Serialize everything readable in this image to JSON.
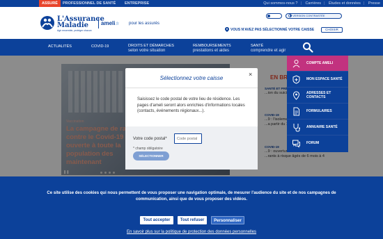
{
  "topbar": {
    "tabs": [
      "Assuré",
      "Professionnel de santé",
      "Entreprise"
    ],
    "links": [
      "Qui sommes-nous ?",
      "Carrières",
      "Études et données",
      "Presse"
    ]
  },
  "header": {
    "logo_line1": "L'Assurance",
    "logo_line2": "Maladie",
    "logo_tagline": "Agir ensemble, protéger chacun",
    "ameli": "ameli",
    "ameli_suffix": ".fr",
    "pour": "pour les assurés",
    "version_label": "VERSION CONTRASTÉE",
    "caisse_status": "VOUS N'AVEZ PAS SÉLECTIONNÉ VOTRE CAISSE",
    "choisir": "CHOISIR"
  },
  "nav": {
    "items": [
      {
        "main": "ACTUALITÉS",
        "sub": ""
      },
      {
        "main": "COVID-19",
        "sub": ""
      },
      {
        "main": "DROITS ET DÉMARCHES",
        "sub": "selon votre situation"
      },
      {
        "main": "REMBOURSEMENTS",
        "sub": "prestations et aides"
      },
      {
        "main": "SANTÉ",
        "sub": "comprendre et agir"
      }
    ]
  },
  "dropdown": {
    "items": [
      {
        "label": "COMPTE AMELI",
        "icon": "person-icon"
      },
      {
        "label": "MON ESPACE SANTÉ",
        "icon": "shield-cross-icon"
      },
      {
        "label": "ADRESSES ET CONTACTS",
        "icon": "location-icon"
      },
      {
        "label": "FORMULAIRES",
        "icon": "document-icon"
      },
      {
        "label": "ANNUAIRE SANTÉ",
        "icon": "stethoscope-icon"
      },
      {
        "label": "FORUM",
        "icon": "chat-icon"
      }
    ]
  },
  "hero": {
    "tag": "Vaccination",
    "title": "La campagne de rappel contre le Covid-19 est ouverte à toute la population des maintenant"
  },
  "brief": {
    "title": "EN BR",
    "rows": [
      {
        "cat": "SANTÉ ET PRÉ",
        "text": "...ion du suicide ...disponibles ?"
      },
      {
        "cat": "COVID-19",
        "text": "...9 : l'isolement n... ...pour les pers... ...a partir du 1er..."
      },
      {
        "cat": "COVID-19",
        "text": "...9 : ouverture de la vaccination ...rants à risque âgés de 6 mois à 4"
      }
    ]
  },
  "modal": {
    "title": "Sélectionnez votre caisse",
    "close": "×",
    "description": "Saisissez le code postal de votre lieu de résidence. Les pages d'ameli seront alors enrichies d'informations locales (contacts, événements régionaux...).",
    "label": "Votre code postal*",
    "placeholder": "Code postal",
    "required": "* champ obligatoire",
    "button": "SÉLECTIONNER"
  },
  "cookie": {
    "text": "Ce site utilise des cookies qui nous permettent de vous proposer une navigation optimale, de mesurer l'audience du site et de nos campagnes de communication, ainsi que de vous proposer des vidéos.",
    "accept": "Tout accepter",
    "refuse": "Tout refuser",
    "customize": "Personnaliser",
    "link": "En savoir plus sur la politique de protection des données personnelles"
  }
}
